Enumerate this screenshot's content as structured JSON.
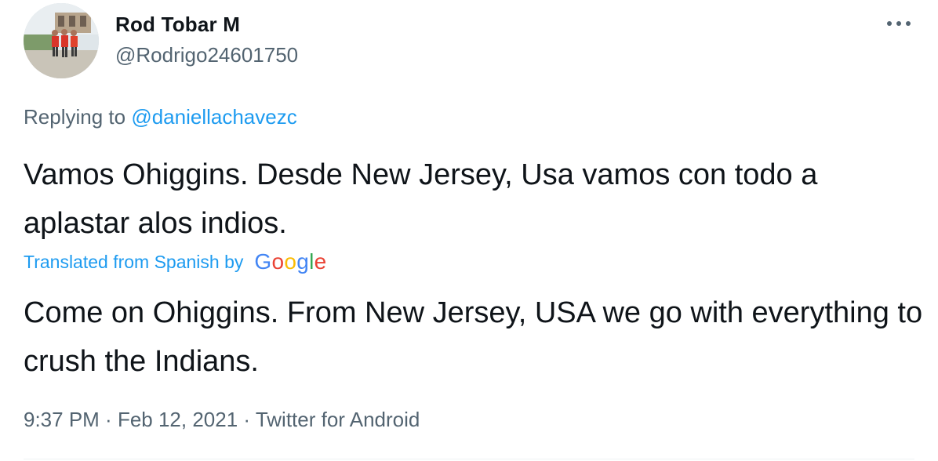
{
  "author": {
    "name": "Rod Tobar M",
    "handle": "@Rodrigo24601750"
  },
  "reply": {
    "prefix": "Replying to ",
    "target": "@daniellachavezc"
  },
  "tweet": {
    "text": "Vamos Ohiggins. Desde New Jersey, Usa vamos con todo a aplastar alos indios."
  },
  "translation": {
    "label": "Translated from Spanish by",
    "provider_letters": [
      "G",
      "o",
      "o",
      "g",
      "l",
      "e"
    ],
    "provider_colors": [
      "#4285F4",
      "#EA4335",
      "#FBBC05",
      "#4285F4",
      "#34A853",
      "#EA4335"
    ],
    "text": "Come on Ohiggins. From New Jersey, USA we go with everything to crush the Indians."
  },
  "meta": {
    "time": "9:37 PM",
    "separator": " · ",
    "date": "Feb 12, 2021",
    "app": "Twitter for Android"
  },
  "icons": {
    "more": "more-horizontal-icon",
    "avatar": "profile-photo"
  },
  "colors": {
    "link": "#1d9bf0",
    "secondary_text": "#536471",
    "primary_text": "#0f1419"
  }
}
